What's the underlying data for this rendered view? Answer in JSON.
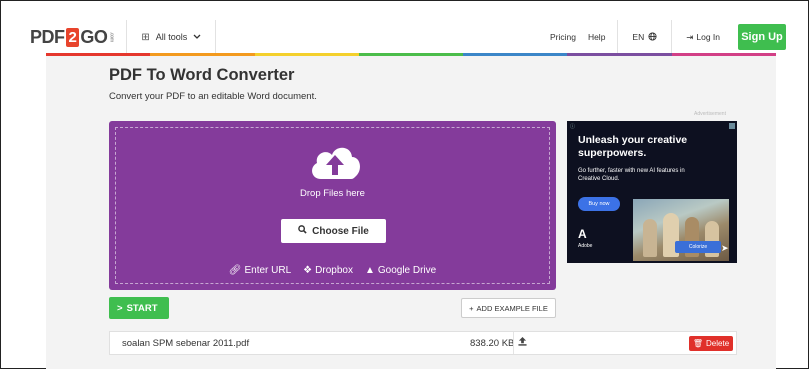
{
  "header": {
    "logo": {
      "left": "PDF",
      "mid": "2",
      "right": "GO",
      "suffix": ".com"
    },
    "all_tools": "All tools",
    "pricing": "Pricing",
    "help": "Help",
    "lang": "EN",
    "login": "Log In",
    "signup": "Sign Up"
  },
  "rainbow_colors": [
    "#e5372d",
    "#f39a1e",
    "#f4d02c",
    "#4bbd4a",
    "#3b86c8",
    "#7b4ea0",
    "#d23f86"
  ],
  "page": {
    "title": "PDF To Word Converter",
    "subtitle": "Convert your PDF to an editable Word document."
  },
  "upload": {
    "drop_label": "Drop Files here",
    "choose_label": "Choose File",
    "enter_url": "Enter URL",
    "dropbox": "Dropbox",
    "google_drive": "Google Drive",
    "bg_color": "#843b9b"
  },
  "ad": {
    "label": "Advertisement",
    "headline": "Unleash your creative superpowers.",
    "subline": "Go further, faster with new AI features in Creative Cloud.",
    "button": "Buy now",
    "brand": "Adobe",
    "colorize": "Colorize"
  },
  "actions": {
    "start": "START",
    "add_example": "ADD EXAMPLE FILE"
  },
  "file": {
    "name": "soalan SPM sebenar 2011.pdf",
    "size": "838.20 KB",
    "delete": "Delete"
  }
}
